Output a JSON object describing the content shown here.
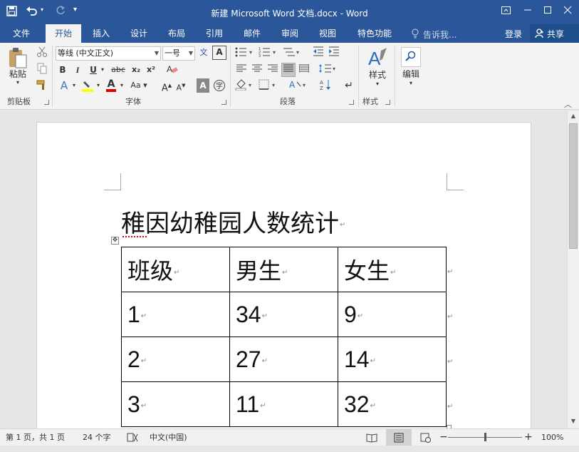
{
  "app": {
    "window_title": "新建 Microsoft Word 文档.docx - Word",
    "login_label": "登录",
    "share_label": "共享",
    "tell_me_placeholder": "告诉我..."
  },
  "qat": {
    "save": "save-icon",
    "undo": "undo-icon",
    "redo": "redo-icon",
    "customize": "▾"
  },
  "tabs": [
    {
      "label": "文件",
      "active": false
    },
    {
      "label": "开始",
      "active": true
    },
    {
      "label": "插入",
      "active": false
    },
    {
      "label": "设计",
      "active": false
    },
    {
      "label": "布局",
      "active": false
    },
    {
      "label": "引用",
      "active": false
    },
    {
      "label": "邮件",
      "active": false
    },
    {
      "label": "审阅",
      "active": false
    },
    {
      "label": "视图",
      "active": false
    },
    {
      "label": "特色功能",
      "active": false
    }
  ],
  "ribbon": {
    "clipboard": {
      "paste_label": "粘贴",
      "group_label": "剪贴板"
    },
    "font": {
      "font_name": "等线 (中文正文)",
      "font_size": "一号",
      "bold": "B",
      "italic": "I",
      "underline": "U",
      "strike": "abc",
      "subscript": "x₂",
      "superscript": "x²",
      "grow": "A",
      "shrink": "A",
      "font_color_letter": "A",
      "group_label": "字体"
    },
    "paragraph": {
      "group_label": "段落"
    },
    "styles": {
      "label": "样式",
      "group_label": "样式"
    },
    "editing": {
      "label": "编辑"
    }
  },
  "document": {
    "title": "稚因幼稚园人数统计",
    "table": [
      [
        "班级",
        "男生",
        "女生"
      ],
      [
        "1",
        "34",
        "9"
      ],
      [
        "2",
        "27",
        "14"
      ],
      [
        "3",
        "11",
        "32"
      ]
    ],
    "paragraph_mark": "↵"
  },
  "status": {
    "page": "第 1 页，共 1 页",
    "words": "24 个字",
    "language": "中文(中国)",
    "zoom": "100%",
    "zoom_minus": "−",
    "zoom_plus": "+"
  },
  "colors": {
    "accent": "#2b579a",
    "highlight": "#ffff00",
    "font_color": "#e00000"
  }
}
